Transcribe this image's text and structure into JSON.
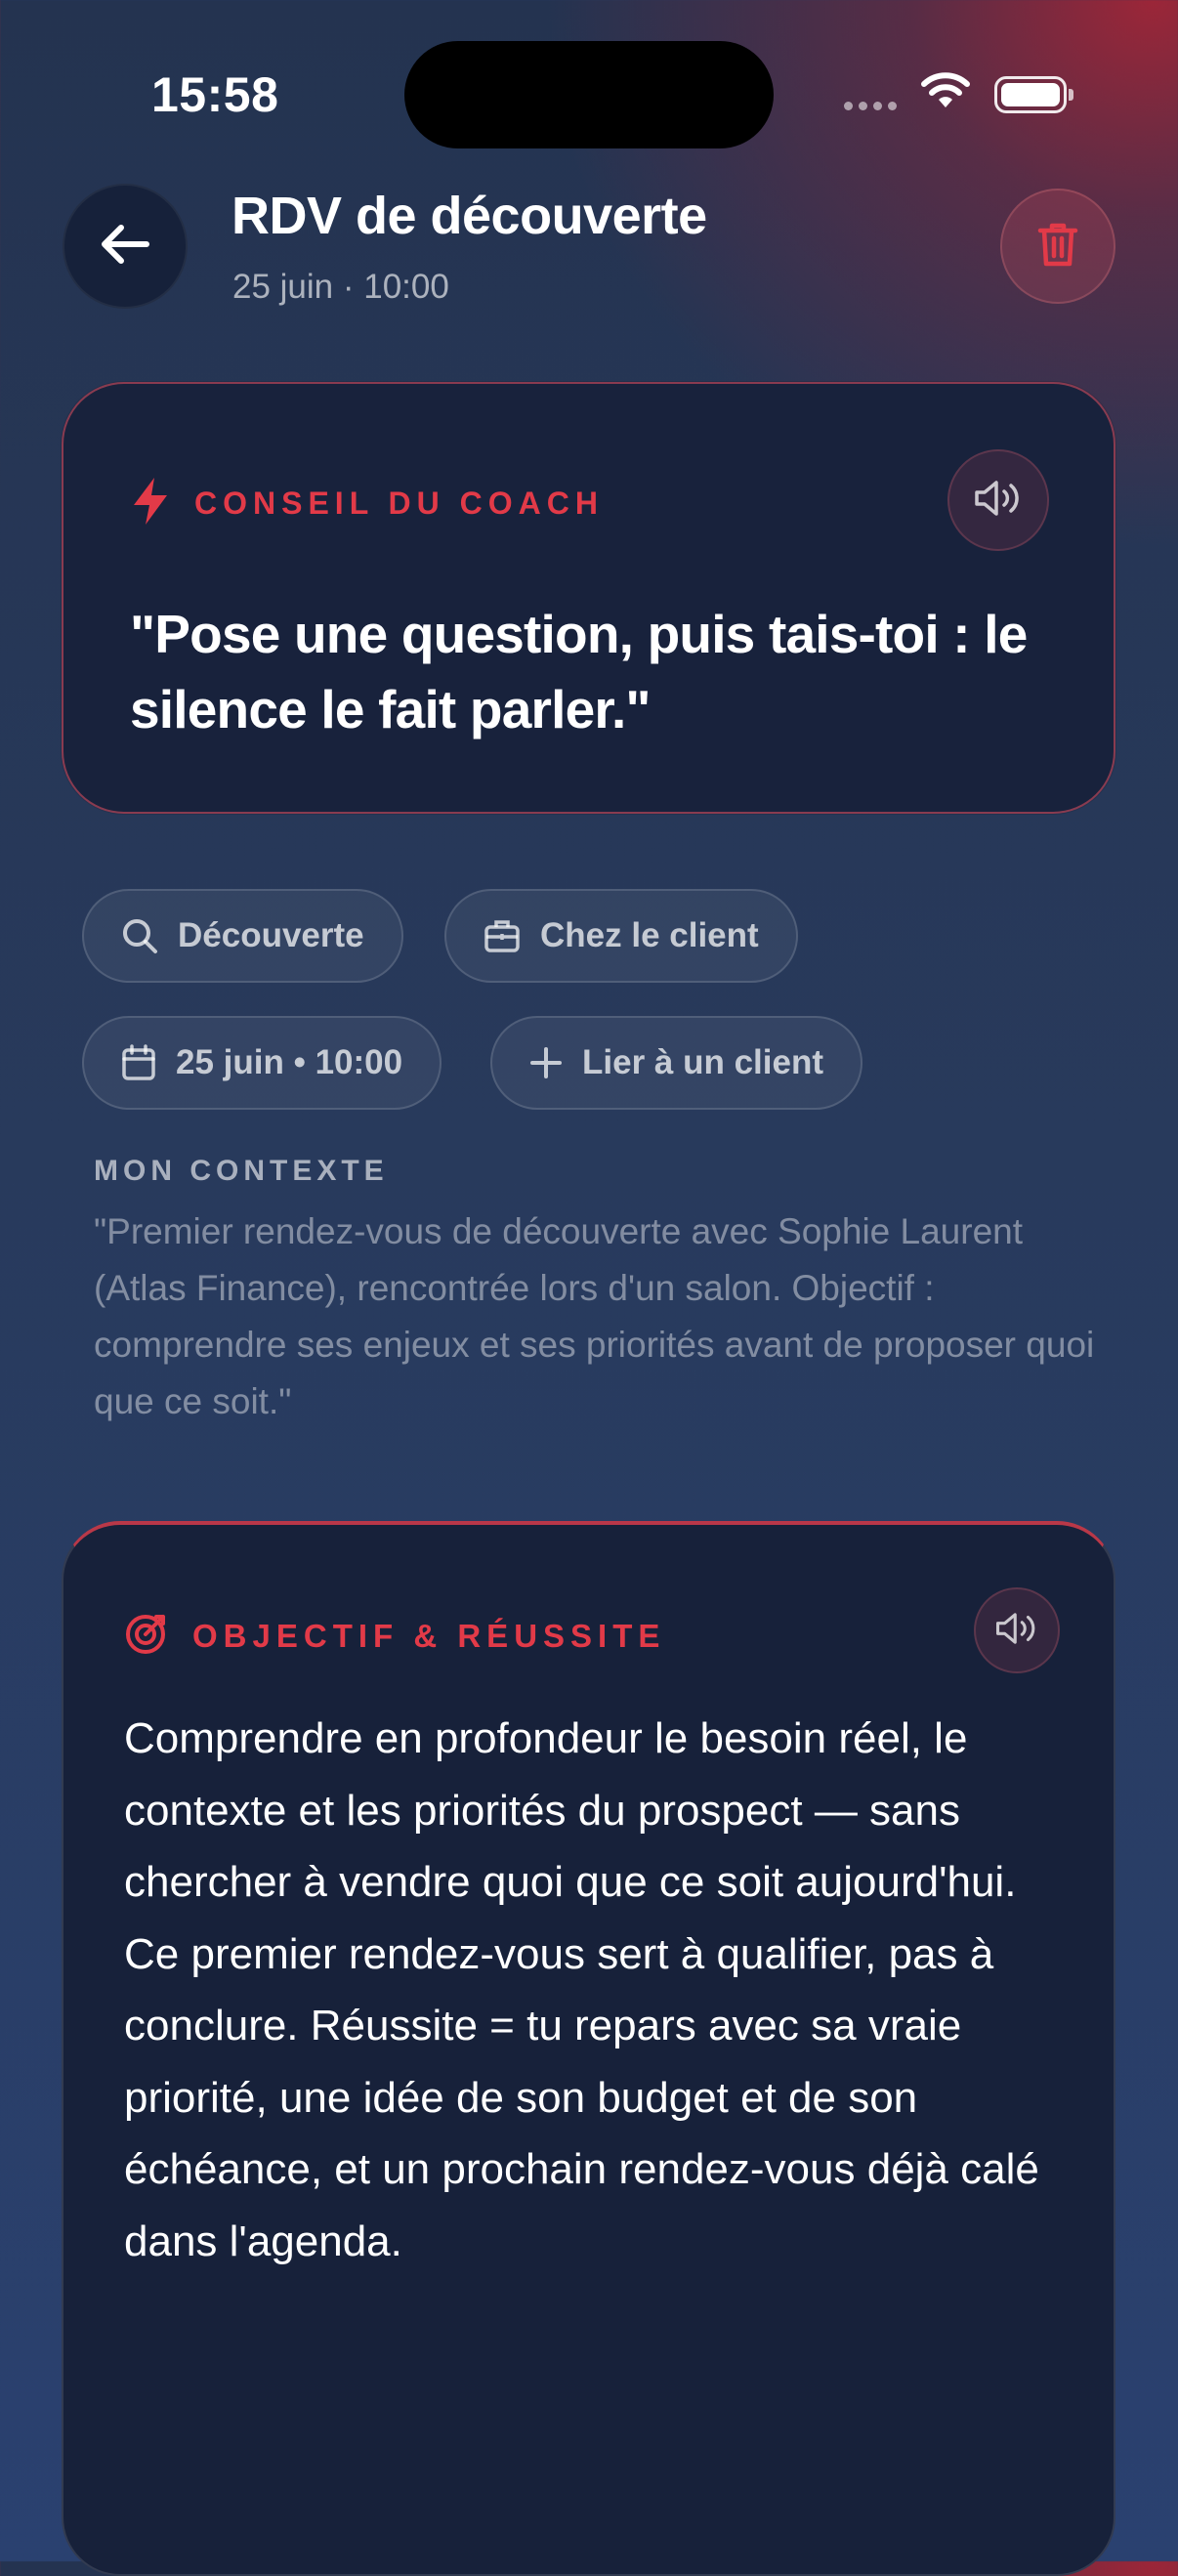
{
  "status_bar": {
    "time": "15:58"
  },
  "header": {
    "title": "RDV de découverte",
    "subtitle": "25 juin · 10:00"
  },
  "coach": {
    "label": "CONSEIL DU COACH",
    "quote": "\"Pose une question, puis tais-toi : le silence le fait parler.\""
  },
  "chips": {
    "type": "Découverte",
    "location": "Chez le client",
    "date": "25 juin • 10:00",
    "link_client": "Lier à un client"
  },
  "context": {
    "label": "MON CONTEXTE",
    "text": "\"Premier rendez-vous de découverte avec Sophie Laurent (Atlas Finance), rencontrée lors d'un salon. Objectif : comprendre ses enjeux et ses priorités avant de proposer quoi que ce soit.\""
  },
  "objective": {
    "label": "OBJECTIF & RÉUSSITE",
    "text": "Comprendre en profondeur le besoin réel, le contexte et les priorités du prospect — sans chercher à vendre quoi que ce soit aujourd'hui. Ce premier rendez-vous sert à qualifier, pas à conclure. Réussite = tu repars avec sa vraie priorité, une idée de son budget et de son échéance, et un prochain rendez-vous déjà calé dans l'agenda."
  },
  "icons": {
    "back": "arrow-left-icon",
    "delete": "trash-icon",
    "coach": "lightning-bolt-icon",
    "audio": "speaker-icon",
    "type": "search-icon",
    "location": "briefcase-icon",
    "date": "calendar-icon",
    "link": "plus-icon",
    "objective": "target-icon"
  },
  "colors": {
    "accent": "#e23a48",
    "card": "#18223c",
    "background": "#283a5c"
  }
}
